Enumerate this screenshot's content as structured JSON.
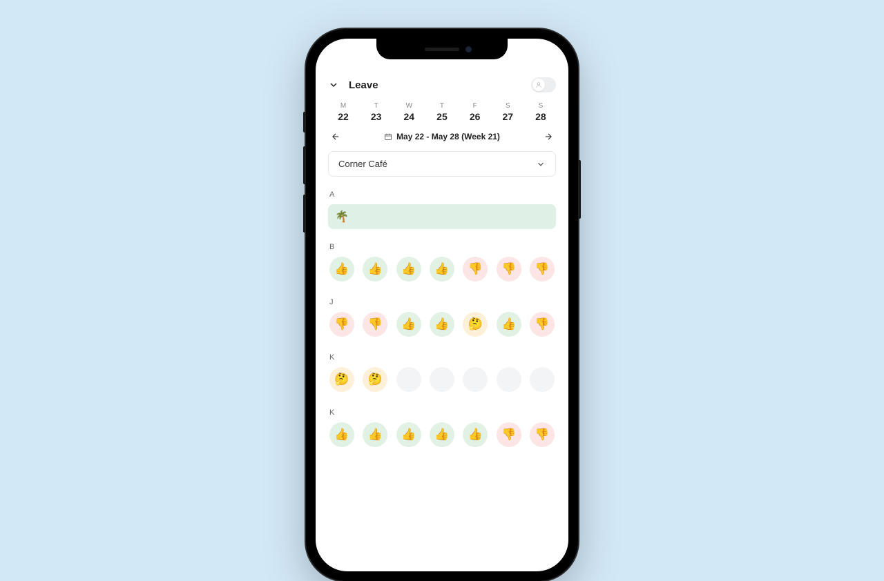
{
  "header": {
    "title": "Leave"
  },
  "week": {
    "days": [
      {
        "letter": "M",
        "num": "22"
      },
      {
        "letter": "T",
        "num": "23"
      },
      {
        "letter": "W",
        "num": "24"
      },
      {
        "letter": "T",
        "num": "25"
      },
      {
        "letter": "F",
        "num": "26"
      },
      {
        "letter": "S",
        "num": "27"
      },
      {
        "letter": "S",
        "num": "28"
      }
    ],
    "range_label": "May 22 - May 28 (Week 21)"
  },
  "location_select": {
    "value": "Corner Café"
  },
  "groups": [
    {
      "label": "A",
      "type": "palm",
      "palm_icon": "🌴"
    },
    {
      "label": "B",
      "type": "emoji",
      "cells": [
        {
          "bg": "bg-up",
          "emoji": "👍"
        },
        {
          "bg": "bg-up",
          "emoji": "👍"
        },
        {
          "bg": "bg-up",
          "emoji": "👍"
        },
        {
          "bg": "bg-up",
          "emoji": "👍"
        },
        {
          "bg": "bg-down",
          "emoji": "👎"
        },
        {
          "bg": "bg-down",
          "emoji": "👎"
        },
        {
          "bg": "bg-down",
          "emoji": "👎"
        }
      ]
    },
    {
      "label": "J",
      "type": "emoji",
      "cells": [
        {
          "bg": "bg-down",
          "emoji": "👎"
        },
        {
          "bg": "bg-down",
          "emoji": "👎"
        },
        {
          "bg": "bg-up",
          "emoji": "👍"
        },
        {
          "bg": "bg-up",
          "emoji": "👍"
        },
        {
          "bg": "bg-think",
          "emoji": "🤔"
        },
        {
          "bg": "bg-up",
          "emoji": "👍"
        },
        {
          "bg": "bg-down",
          "emoji": "👎"
        }
      ]
    },
    {
      "label": "K",
      "type": "emoji",
      "cells": [
        {
          "bg": "bg-think",
          "emoji": "🤔"
        },
        {
          "bg": "bg-think",
          "emoji": "🤔"
        },
        {
          "bg": "bg-empty",
          "emoji": ""
        },
        {
          "bg": "bg-empty",
          "emoji": ""
        },
        {
          "bg": "bg-empty",
          "emoji": ""
        },
        {
          "bg": "bg-empty",
          "emoji": ""
        },
        {
          "bg": "bg-empty",
          "emoji": ""
        }
      ]
    },
    {
      "label": "K",
      "type": "emoji",
      "cells": [
        {
          "bg": "bg-up",
          "emoji": "👍"
        },
        {
          "bg": "bg-up",
          "emoji": "👍"
        },
        {
          "bg": "bg-up",
          "emoji": "👍"
        },
        {
          "bg": "bg-up",
          "emoji": "👍"
        },
        {
          "bg": "bg-up",
          "emoji": "👍"
        },
        {
          "bg": "bg-down",
          "emoji": "👎"
        },
        {
          "bg": "bg-down",
          "emoji": "👎"
        }
      ]
    }
  ]
}
